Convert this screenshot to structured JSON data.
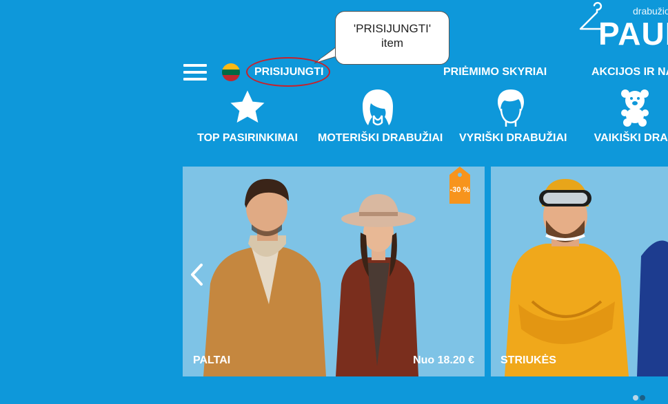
{
  "logo": {
    "tagline": "drabužio",
    "name": "PAULI"
  },
  "callout": {
    "line1": "'PRISIJUNGTI'",
    "line2": "item"
  },
  "nav": {
    "login": "PRISIJUNGTI",
    "receiving": "PRIĖMIMO SKYRIAI",
    "sales": "AKCIJOS IR NA"
  },
  "categories": [
    {
      "label": "TOP PASIRINKIMAI",
      "icon": "star-icon"
    },
    {
      "label": "MOTERIŠKI DRABUŽIAI",
      "icon": "woman-hair-icon"
    },
    {
      "label": "VYRIŠKI DRABUŽIAI",
      "icon": "man-hair-icon"
    },
    {
      "label": "VAIKIŠKI DRAB",
      "icon": "teddy-bear-icon"
    }
  ],
  "cards": [
    {
      "title": "PALTAI",
      "price": "Nuo 18.20 €",
      "discount": "-30 %"
    },
    {
      "title": "STRIUKĖS"
    }
  ],
  "colors": {
    "background": "#0e98da",
    "highlight_ring": "#c8202a",
    "discount_tag": "#f7941d",
    "flag_yellow": "#fdb913",
    "flag_green": "#006a44",
    "flag_red": "#c1272d"
  }
}
